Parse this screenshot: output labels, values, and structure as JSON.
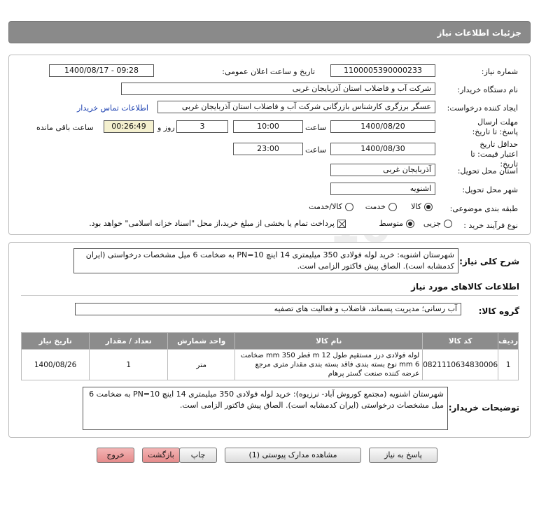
{
  "header": {
    "title": "جزئیات اطلاعات نیاز"
  },
  "form": {
    "need_number_label": "شماره نیاز:",
    "need_number": "1100005390000233",
    "announce_label": "تاریخ و ساعت اعلان عمومی:",
    "announce_value": "1400/08/17 - 09:28",
    "buyer_org_label": "نام دستگاه خریدار:",
    "buyer_org": "شرکت آب و فاضلاب استان آذربایجان غربی",
    "creator_label": "ایجاد کننده درخواست:",
    "creator": "عسگر  برزگری کارشناس بازرگانی شرکت آب و فاضلاب استان آذربایجان غربی",
    "contact_link": "اطلاعات تماس خریدار",
    "deadline_label": "مهلت ارسال پاسخ: تا تاریخ:",
    "deadline_date": "1400/08/20",
    "time_label": "ساعت",
    "deadline_time": "10:00",
    "days_value": "3",
    "days_label": "روز و",
    "remaining_time": "00:26:49",
    "remaining_label": "ساعت باقی مانده",
    "validity_label": "حداقل تاریخ اعتبار قیمت: تا تاریخ:",
    "validity_date": "1400/08/30",
    "validity_time_label": "ساعت",
    "validity_time": "23:00",
    "province_label": "استان محل تحویل:",
    "province": "آذربایجان غربی",
    "city_label": "شهر محل تحویل:",
    "city": "اشنویه",
    "category_label": "طبقه بندی موضوعی:",
    "category_options": [
      "کالا",
      "خدمت",
      "کالا/خدمت"
    ],
    "process_label": "نوع فرآیند خرید :",
    "process_options": [
      "جزیی",
      "متوسط"
    ],
    "payment_note": "پرداخت تمام یا بخشی از مبلغ خرید،از محل \"اسناد خزانه اسلامی\" خواهد بود."
  },
  "summary": {
    "label": "شرح کلی نیاز:",
    "text": "شهرستان اشنویه: خرید لوله فولادی 350 میلیمتری 14 اینچ PN=10 به ضخامت 6 میل مشخصات درخواستی (ایران کدمشابه است). الصاق پیش فاکتور الزامی است.",
    "goods_info_title": "اطلاعات کالاهای مورد نیاز",
    "group_label": "گروه کالا:",
    "group_value": "آب رسانی؛ مدیریت پسماند، فاضلاب و فعالیت های تصفیه"
  },
  "table": {
    "headers": [
      "ردیف",
      "کد کالا",
      "نام کالا",
      "واحد شمارش",
      "تعداد / مقدار",
      "تاریخ نیاز"
    ],
    "rows": [
      {
        "row": "1",
        "code": "0821110634830006",
        "name": "لوله فولادی درز مستقیم طول 12 m قطر 350 mm ضخامت 6 mm نوع بسته بندی فاقد بسته بندی مقدار متری مرجع عرضه کننده صنعت گستر پرهام",
        "unit": "متر",
        "qty": "1",
        "date": "1400/08/26"
      }
    ]
  },
  "buyer_notes": {
    "label": "توضیحات خریدار:",
    "text": "شهرستان اشنویه (مجتمع کوروش آباد- نرزیوه): خرید لوله فولادی 350 میلیمتری 14 اینچ PN=10 به ضخامت 6 میل مشخصات درخواستی (ایران کدمشابه است). الصاق پیش فاکتور الزامی است."
  },
  "buttons": {
    "reply": "پاسخ به نیاز",
    "attachments": "مشاهده مدارک پیوستی (1)",
    "print": "چاپ",
    "back": "بازگشت",
    "exit": "خروج"
  },
  "watermark": {
    "main": "ParsNamadData"
  }
}
